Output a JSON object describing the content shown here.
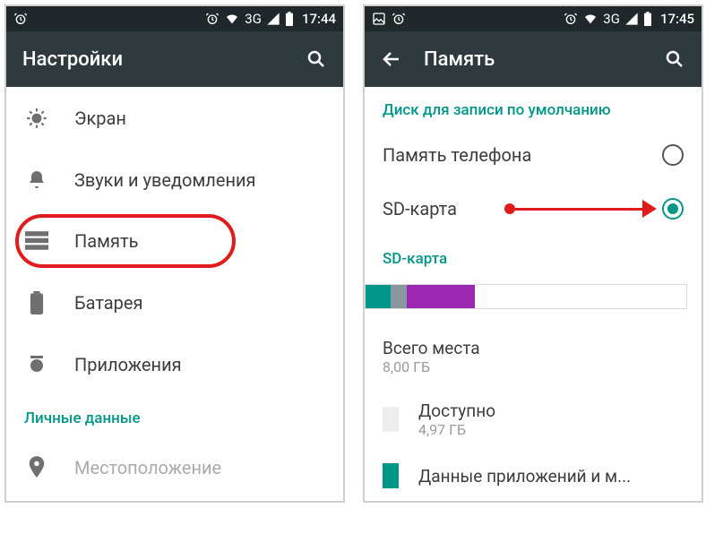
{
  "left": {
    "status": {
      "time": "17:44",
      "net": "3G"
    },
    "appbar": {
      "title": "Настройки"
    },
    "items": {
      "display": "Экран",
      "sound": "Звуки и уведомления",
      "storage": "Память",
      "battery": "Батарея",
      "apps": "Приложения"
    },
    "section_personal": "Личные данные",
    "location": "Местоположение"
  },
  "right": {
    "status": {
      "time": "17:45",
      "net": "3G"
    },
    "appbar": {
      "title": "Память"
    },
    "section_default_disk": "Диск для записи по умолчанию",
    "opt_phone": "Память телефона",
    "opt_sd": "SD-карта",
    "section_sd": "SD-карта",
    "total_label": "Всего места",
    "total_value": "8,00 ГБ",
    "avail_label": "Доступно",
    "avail_value": "4,97 ГБ",
    "appdata_label": "Данные приложений и м..."
  }
}
